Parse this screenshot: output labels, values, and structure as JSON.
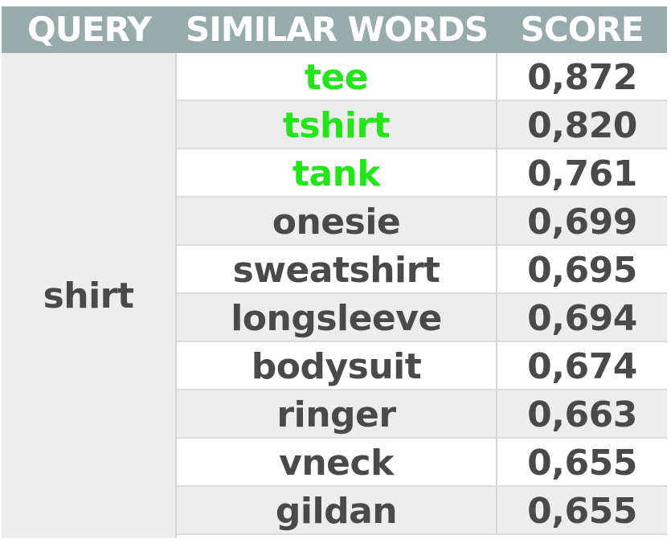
{
  "table": {
    "headers": {
      "query": "QUERY",
      "similar_words": "SIMILAR WORDS",
      "score": "SCORE"
    },
    "query": "shirt",
    "highlight_color": "#22e51a",
    "header_color": "#97abaa",
    "rows": [
      {
        "word": "tee",
        "score": "0,872",
        "highlighted": true
      },
      {
        "word": "tshirt",
        "score": "0,820",
        "highlighted": true
      },
      {
        "word": "tank",
        "score": "0,761",
        "highlighted": true
      },
      {
        "word": "onesie",
        "score": "0,699",
        "highlighted": false
      },
      {
        "word": "sweatshirt",
        "score": "0,695",
        "highlighted": false
      },
      {
        "word": "longsleeve",
        "score": "0,694",
        "highlighted": false
      },
      {
        "word": "bodysuit",
        "score": "0,674",
        "highlighted": false
      },
      {
        "word": "ringer",
        "score": "0,663",
        "highlighted": false
      },
      {
        "word": "vneck",
        "score": "0,655",
        "highlighted": false
      },
      {
        "word": "gildan",
        "score": "0,655",
        "highlighted": false
      }
    ]
  }
}
